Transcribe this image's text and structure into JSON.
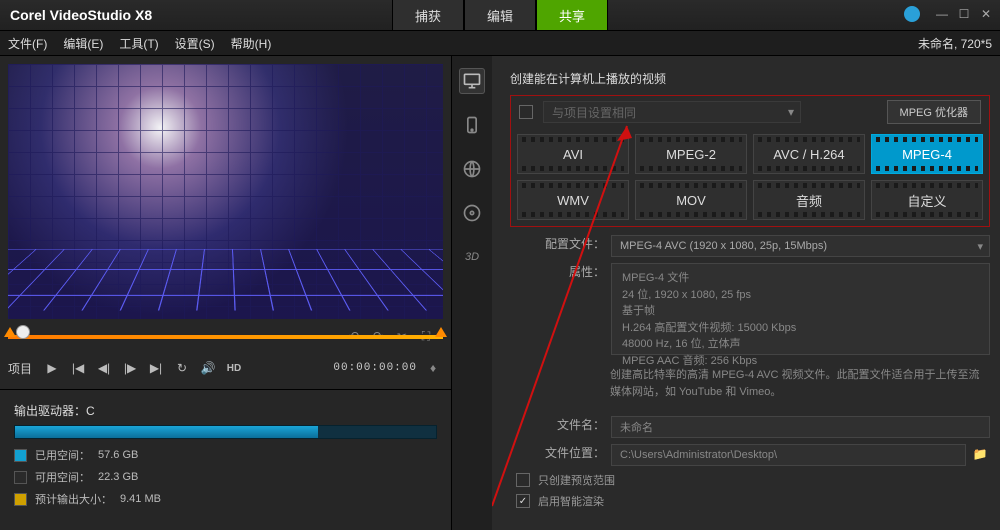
{
  "app": {
    "title": "Corel VideoStudio X8"
  },
  "topTabs": {
    "capture": "捕获",
    "edit": "编辑",
    "share": "共享"
  },
  "project": {
    "name": "未命名",
    "res": "720*5"
  },
  "menu": {
    "file": "文件(F)",
    "edit": "编辑(E)",
    "tools": "工具(T)",
    "settings": "设置(S)",
    "help": "帮助(H)"
  },
  "player": {
    "projectLabel": "项目",
    "timecode": "00:00:00:00",
    "hd": "HD"
  },
  "drive": {
    "title": "输出驱动器：C",
    "usedLabel": "已用空间：",
    "usedValue": "57.6 GB",
    "freeLabel": "可用空间：",
    "freeValue": "22.3 GB",
    "estLabel": "预计输出大小：",
    "estValue": "9.41 MB",
    "usedPct": 72
  },
  "share": {
    "heading": "创建能在计算机上播放的视频",
    "sameSettingsChk": "与项目设置相同",
    "mpegOptimizer": "MPEG 优化器",
    "formats": {
      "avi": "AVI",
      "mpeg2": "MPEG-2",
      "avc": "AVC / H.264",
      "mpeg4": "MPEG-4",
      "wmv": "WMV",
      "mov": "MOV",
      "audio": "音频",
      "custom": "自定义"
    },
    "profileLabel": "配置文件：",
    "profileValue": "MPEG-4 AVC (1920 x 1080, 25p, 15Mbps)",
    "propsLabel": "属性：",
    "props": {
      "l1": "MPEG-4 文件",
      "l2": "24 位, 1920 x 1080, 25 fps",
      "l3": "基于帧",
      "l4": "H.264 高配置文件视频: 15000 Kbps",
      "l5": "48000 Hz, 16 位, 立体声",
      "l6": "MPEG AAC 音频: 256 Kbps"
    },
    "desc": "创建高比特率的高清 MPEG-4 AVC 视频文件。此配置文件适合用于上传至流媒体网站，如 YouTube 和 Vimeo。",
    "filenameLabel": "文件名：",
    "filenameValue": "未命名",
    "locationLabel": "文件位置：",
    "locationValue": "C:\\Users\\Administrator\\Desktop\\",
    "onlyPreview": "只创建预览范围",
    "smartRender": "启用智能渲染"
  }
}
